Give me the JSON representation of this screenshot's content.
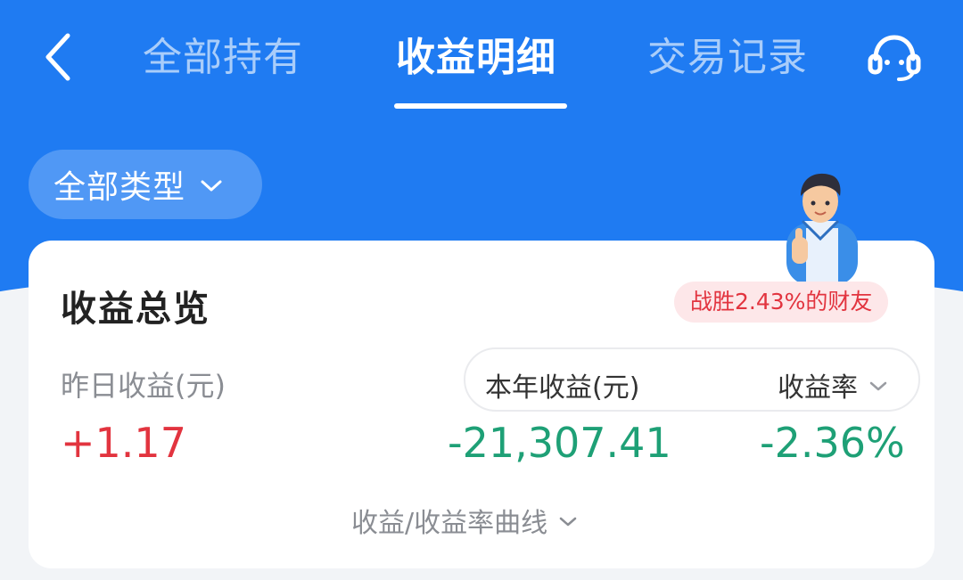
{
  "header": {
    "tabs": [
      {
        "label": "全部持有",
        "active": false
      },
      {
        "label": "收益明细",
        "active": true
      },
      {
        "label": "交易记录",
        "active": false
      }
    ],
    "back_icon": "back-chevron-icon",
    "service_icon": "customer-service-icon"
  },
  "filter": {
    "label": "全部类型",
    "icon": "chevron-down-icon"
  },
  "overview": {
    "title": "收益总览",
    "badge": "战胜2.43%的财友",
    "yesterday_label": "昨日收益(元)",
    "yesterday_value": "+1.17",
    "year_label": "本年收益(元)",
    "year_value": "-21,307.41",
    "rate_label": "收益率",
    "rate_value": "-2.36%",
    "curve_toggle": "收益/收益率曲线"
  },
  "colors": {
    "header_blue": "#1f7bf2",
    "gain_red": "#e2343f",
    "loss_green": "#1ea076",
    "badge_bg": "#fde7e9"
  }
}
